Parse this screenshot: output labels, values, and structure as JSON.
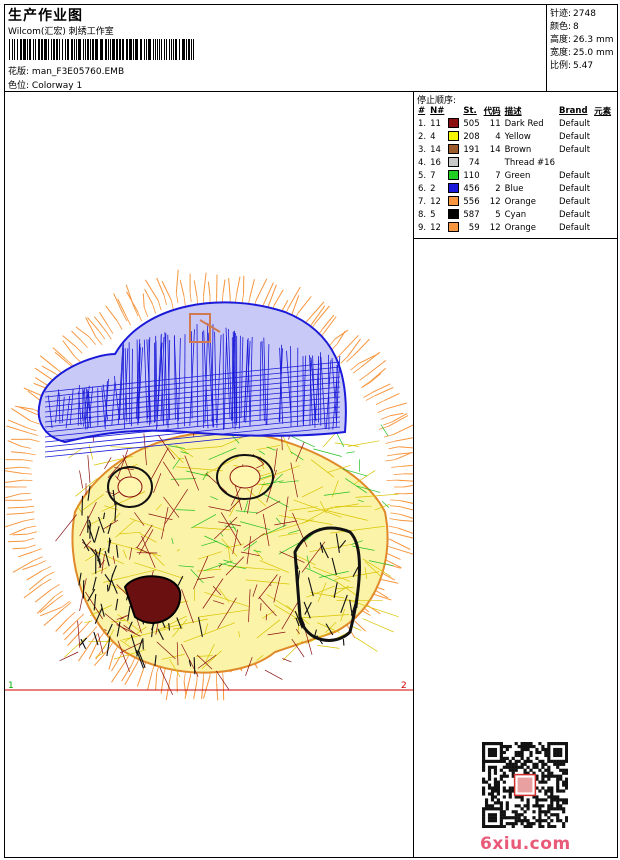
{
  "header": {
    "title": "生产作业图",
    "subtitle": "Wilcom(汇宏) 刺绣工作室",
    "design_label": "花版:",
    "design_value": "man_F3E05760.EMB",
    "colorway_label": "色位:",
    "colorway_value": "Colorway 1"
  },
  "stats": [
    {
      "label": "针迹:",
      "value": "2748"
    },
    {
      "label": "颜色:",
      "value": "8"
    },
    {
      "label": "高度:",
      "value": "26.3 mm"
    },
    {
      "label": "宽度:",
      "value": "25.0 mm"
    },
    {
      "label": "比例:",
      "value": "5.47"
    }
  ],
  "stop_sequence": {
    "title": "停止顺序:",
    "headers": [
      "#",
      "N#",
      "St.",
      "代码",
      "描述",
      "Brand",
      "元素"
    ],
    "rows": [
      {
        "idx": "1.",
        "n": "11",
        "color": "#8b0f0f",
        "st": "505",
        "code": "11",
        "desc": "Dark Red",
        "brand": "Default"
      },
      {
        "idx": "2.",
        "n": "4",
        "color": "#f5f500",
        "st": "208",
        "code": "4",
        "desc": "Yellow",
        "brand": "Default"
      },
      {
        "idx": "3.",
        "n": "14",
        "color": "#9b5b2b",
        "st": "191",
        "code": "14",
        "desc": "Brown",
        "brand": "Default"
      },
      {
        "idx": "4.",
        "n": "16",
        "color": "#c8c8c8",
        "st": "74",
        "code": "",
        "desc": "Thread #16",
        "brand": ""
      },
      {
        "idx": "5.",
        "n": "7",
        "color": "#20d020",
        "st": "110",
        "code": "7",
        "desc": "Green",
        "brand": "Default"
      },
      {
        "idx": "6.",
        "n": "2",
        "color": "#1a1ad8",
        "st": "456",
        "code": "2",
        "desc": "Blue",
        "brand": "Default"
      },
      {
        "idx": "7.",
        "n": "12",
        "color": "#f7963e",
        "st": "556",
        "code": "12",
        "desc": "Orange",
        "brand": "Default"
      },
      {
        "idx": "8.",
        "n": "5",
        "color": "#000000",
        "st": "587",
        "code": "5",
        "desc": "Cyan",
        "brand": "Default"
      },
      {
        "idx": "9.",
        "n": "12",
        "color": "#f7963e",
        "st": "59",
        "code": "12",
        "desc": "Orange",
        "brand": "Default"
      }
    ]
  },
  "canvas": {
    "marker_left": "1",
    "marker_right": "2",
    "marker_left_color": "#00aa00",
    "marker_right_color": "#cc0000"
  },
  "watermark": {
    "brand": "6xiu.com"
  }
}
